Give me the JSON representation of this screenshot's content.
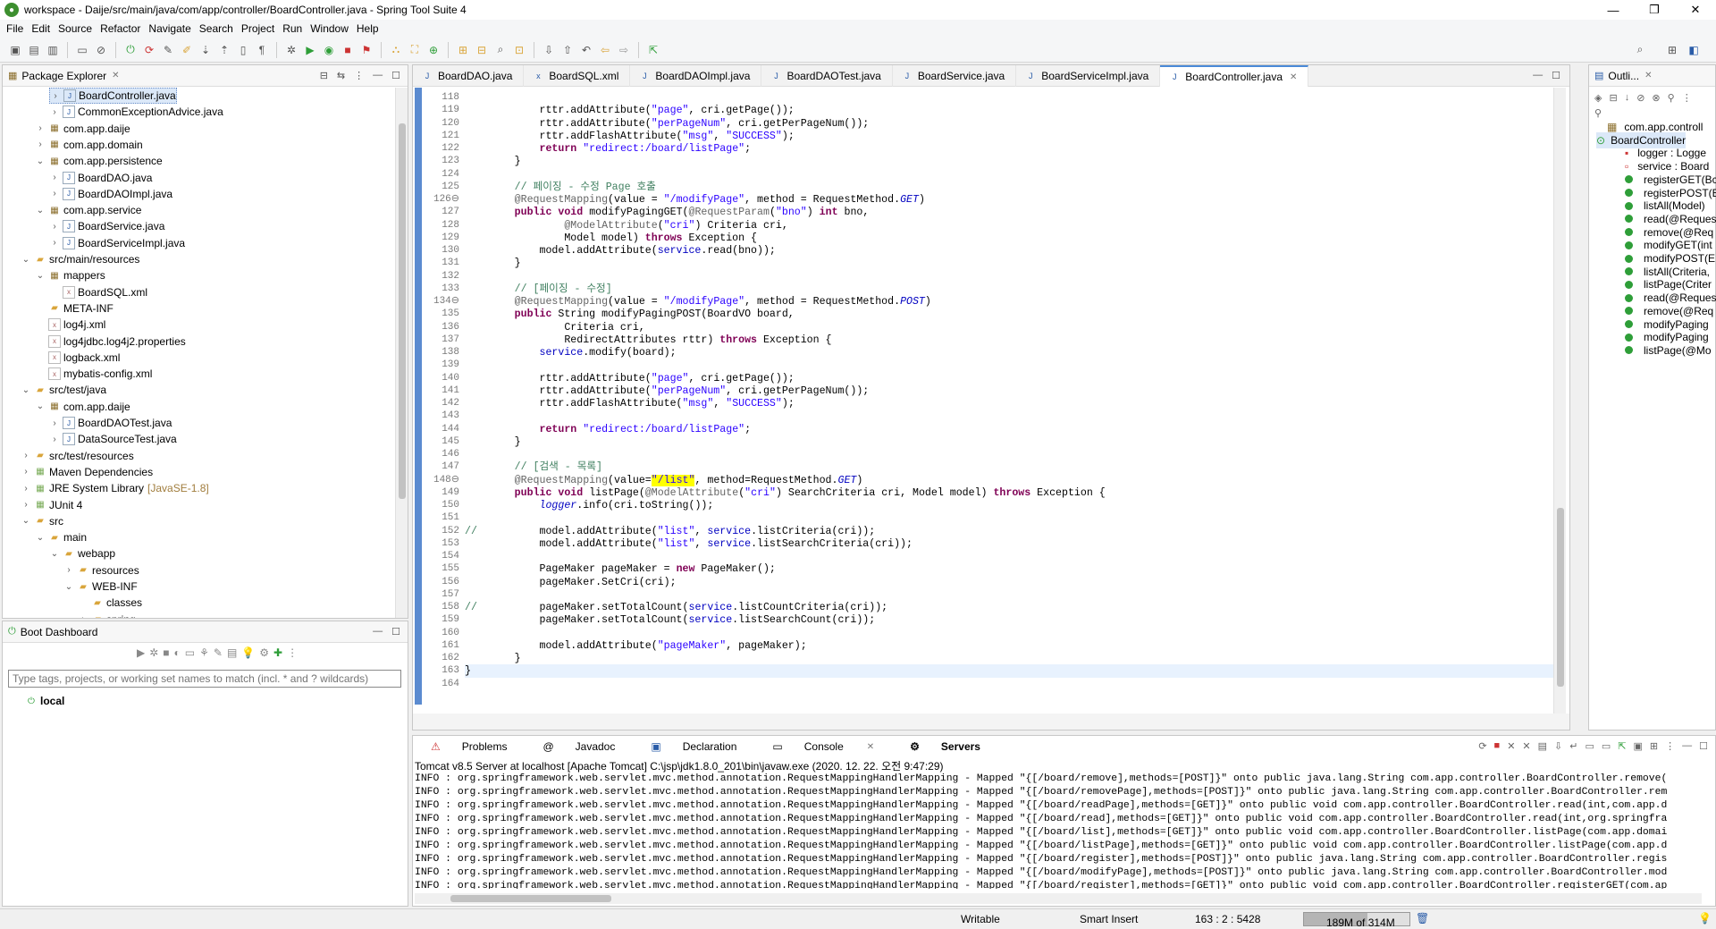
{
  "window": {
    "title": "workspace - Daije/src/main/java/com/app/controller/BoardController.java - Spring Tool Suite 4",
    "minimize": "—",
    "maximize": "❐",
    "close": "✕"
  },
  "menu": [
    "File",
    "Edit",
    "Source",
    "Refactor",
    "Navigate",
    "Search",
    "Project",
    "Run",
    "Window",
    "Help"
  ],
  "package_explorer": {
    "title": "Package Explorer",
    "items": [
      {
        "indent": 3,
        "arrow": ">",
        "icon": "java",
        "label": "BoardController.java"
      },
      {
        "indent": 3,
        "arrow": ">",
        "icon": "java",
        "label": "CommonExceptionAdvice.java"
      },
      {
        "indent": 2,
        "arrow": ">",
        "icon": "pkg",
        "label": "com.app.daije"
      },
      {
        "indent": 2,
        "arrow": ">",
        "icon": "pkg",
        "label": "com.app.domain"
      },
      {
        "indent": 2,
        "arrow": "v",
        "icon": "pkg",
        "label": "com.app.persistence"
      },
      {
        "indent": 3,
        "arrow": ">",
        "icon": "java",
        "label": "BoardDAO.java"
      },
      {
        "indent": 3,
        "arrow": ">",
        "icon": "java",
        "label": "BoardDAOImpl.java"
      },
      {
        "indent": 2,
        "arrow": "v",
        "icon": "pkg",
        "label": "com.app.service"
      },
      {
        "indent": 3,
        "arrow": ">",
        "icon": "java",
        "label": "BoardService.java"
      },
      {
        "indent": 3,
        "arrow": ">",
        "icon": "java",
        "label": "BoardServiceImpl.java"
      },
      {
        "indent": 1,
        "arrow": "v",
        "icon": "fold",
        "label": "src/main/resources"
      },
      {
        "indent": 2,
        "arrow": "v",
        "icon": "pkg",
        "label": "mappers"
      },
      {
        "indent": 3,
        "arrow": "",
        "icon": "xml",
        "label": "BoardSQL.xml"
      },
      {
        "indent": 2,
        "arrow": "",
        "icon": "fold",
        "label": "META-INF"
      },
      {
        "indent": 2,
        "arrow": "",
        "icon": "xml",
        "label": "log4j.xml"
      },
      {
        "indent": 2,
        "arrow": "",
        "icon": "xml",
        "label": "log4jdbc.log4j2.properties"
      },
      {
        "indent": 2,
        "arrow": "",
        "icon": "xml",
        "label": "logback.xml"
      },
      {
        "indent": 2,
        "arrow": "",
        "icon": "xml",
        "label": "mybatis-config.xml"
      },
      {
        "indent": 1,
        "arrow": "v",
        "icon": "fold",
        "label": "src/test/java"
      },
      {
        "indent": 2,
        "arrow": "v",
        "icon": "pkg",
        "label": "com.app.daije"
      },
      {
        "indent": 3,
        "arrow": ">",
        "icon": "java",
        "label": "BoardDAOTest.java"
      },
      {
        "indent": 3,
        "arrow": ">",
        "icon": "java",
        "label": "DataSourceTest.java"
      },
      {
        "indent": 1,
        "arrow": ">",
        "icon": "fold",
        "label": "src/test/resources"
      },
      {
        "indent": 1,
        "arrow": ">",
        "icon": "lib",
        "label": "Maven Dependencies"
      },
      {
        "indent": 1,
        "arrow": ">",
        "icon": "lib",
        "label": "JRE System Library",
        "suffix": "[JavaSE-1.8]"
      },
      {
        "indent": 1,
        "arrow": ">",
        "icon": "lib",
        "label": "JUnit 4"
      },
      {
        "indent": 1,
        "arrow": "v",
        "icon": "fold",
        "label": "src"
      },
      {
        "indent": 2,
        "arrow": "v",
        "icon": "fold",
        "label": "main"
      },
      {
        "indent": 3,
        "arrow": "v",
        "icon": "fold",
        "label": "webapp"
      },
      {
        "indent": 4,
        "arrow": ">",
        "icon": "fold",
        "label": "resources"
      },
      {
        "indent": 4,
        "arrow": "v",
        "icon": "fold",
        "label": "WEB-INF"
      },
      {
        "indent": 5,
        "arrow": "",
        "icon": "fold",
        "label": "classes"
      },
      {
        "indent": 5,
        "arrow": ">",
        "icon": "fold",
        "label": "spring"
      }
    ]
  },
  "boot_dashboard": {
    "title": "Boot Dashboard",
    "search_placeholder": "Type tags, projects, or working set names to match (incl. * and ? wildcards)",
    "local_label": "local"
  },
  "editor": {
    "tabs": [
      "BoardDAO.java",
      "BoardSQL.xml",
      "BoardDAOImpl.java",
      "BoardDAOTest.java",
      "BoardService.java",
      "BoardServiceImpl.java",
      "BoardController.java"
    ],
    "active_tab": "BoardController.java",
    "lines": [
      {
        "n": "118",
        "t": ""
      },
      {
        "n": "119",
        "t": "            rttr.addAttribute(\"page\", cri.getPage());"
      },
      {
        "n": "120",
        "t": "            rttr.addAttribute(\"perPageNum\", cri.getPerPageNum());"
      },
      {
        "n": "121",
        "t": "            rttr.addFlashAttribute(\"msg\", \"SUCCESS\");"
      },
      {
        "n": "122",
        "t": "            return \"redirect:/board/listPage\";"
      },
      {
        "n": "123",
        "t": "        }"
      },
      {
        "n": "124",
        "t": ""
      },
      {
        "n": "125",
        "t": "        // 페이징 - 수정 Page 호출"
      },
      {
        "n": "126⊖",
        "t": "        @RequestMapping(value = \"/modifyPage\", method = RequestMethod.GET)"
      },
      {
        "n": "127",
        "t": "        public void modifyPagingGET(@RequestParam(\"bno\") int bno,"
      },
      {
        "n": "128",
        "t": "                @ModelAttribute(\"cri\") Criteria cri,"
      },
      {
        "n": "129",
        "t": "                Model model) throws Exception {"
      },
      {
        "n": "130",
        "t": "            model.addAttribute(service.read(bno));"
      },
      {
        "n": "131",
        "t": "        }"
      },
      {
        "n": "132",
        "t": ""
      },
      {
        "n": "133",
        "t": "        // [페이징 - 수정]"
      },
      {
        "n": "134⊖",
        "t": "        @RequestMapping(value = \"/modifyPage\", method = RequestMethod.POST)"
      },
      {
        "n": "135",
        "t": "        public String modifyPagingPOST(BoardVO board,"
      },
      {
        "n": "136",
        "t": "                Criteria cri,"
      },
      {
        "n": "137",
        "t": "                RedirectAttributes rttr) throws Exception {"
      },
      {
        "n": "138",
        "t": "            service.modify(board);"
      },
      {
        "n": "139",
        "t": ""
      },
      {
        "n": "140",
        "t": "            rttr.addAttribute(\"page\", cri.getPage());"
      },
      {
        "n": "141",
        "t": "            rttr.addAttribute(\"perPageNum\", cri.getPerPageNum());"
      },
      {
        "n": "142",
        "t": "            rttr.addFlashAttribute(\"msg\", \"SUCCESS\");"
      },
      {
        "n": "143",
        "t": ""
      },
      {
        "n": "144",
        "t": "            return \"redirect:/board/listPage\";"
      },
      {
        "n": "145",
        "t": "        }"
      },
      {
        "n": "146",
        "t": ""
      },
      {
        "n": "147",
        "t": "        // [검색 - 목록]"
      },
      {
        "n": "148⊖",
        "t": "        @RequestMapping(value=\"/list\", method=RequestMethod.GET)"
      },
      {
        "n": "149",
        "t": "        public void listPage(@ModelAttribute(\"cri\") SearchCriteria cri, Model model) throws Exception {"
      },
      {
        "n": "150",
        "t": "            logger.info(cri.toString());"
      },
      {
        "n": "151",
        "t": ""
      },
      {
        "n": "152",
        "t": "//          model.addAttribute(\"list\", service.listCriteria(cri));"
      },
      {
        "n": "153",
        "t": "            model.addAttribute(\"list\", service.listSearchCriteria(cri));"
      },
      {
        "n": "154",
        "t": ""
      },
      {
        "n": "155",
        "t": "            PageMaker pageMaker = new PageMaker();"
      },
      {
        "n": "156",
        "t": "            pageMaker.SetCri(cri);"
      },
      {
        "n": "157",
        "t": ""
      },
      {
        "n": "158",
        "t": "//          pageMaker.setTotalCount(service.listCountCriteria(cri));"
      },
      {
        "n": "159",
        "t": "            pageMaker.setTotalCount(service.listSearchCount(cri));"
      },
      {
        "n": "160",
        "t": ""
      },
      {
        "n": "161",
        "t": "            model.addAttribute(\"pageMaker\", pageMaker);"
      },
      {
        "n": "162",
        "t": "        }"
      },
      {
        "n": "163",
        "t": "}"
      },
      {
        "n": "164",
        "t": ""
      }
    ]
  },
  "outline": {
    "title": "Outli...",
    "items": [
      {
        "kind": "pkg",
        "label": "com.app.controll"
      },
      {
        "kind": "class",
        "label": "BoardController"
      },
      {
        "kind": "field-sf",
        "label": "logger : Logge"
      },
      {
        "kind": "field",
        "label": "service : Board"
      },
      {
        "kind": "method",
        "label": "registerGET(Bc"
      },
      {
        "kind": "method",
        "label": "registerPOST(E"
      },
      {
        "kind": "method",
        "label": "listAll(Model)"
      },
      {
        "kind": "method",
        "label": "read(@Reques"
      },
      {
        "kind": "method",
        "label": "remove(@Req"
      },
      {
        "kind": "method",
        "label": "modifyGET(int"
      },
      {
        "kind": "method",
        "label": "modifyPOST(E"
      },
      {
        "kind": "method",
        "label": "listAll(Criteria,"
      },
      {
        "kind": "method",
        "label": "listPage(Criter"
      },
      {
        "kind": "method",
        "label": "read(@Reques"
      },
      {
        "kind": "method",
        "label": "remove(@Req"
      },
      {
        "kind": "method",
        "label": "modifyPaging"
      },
      {
        "kind": "method",
        "label": "modifyPaging"
      },
      {
        "kind": "method",
        "label": "listPage(@Mo"
      }
    ]
  },
  "console": {
    "tabs": [
      "Problems",
      "Javadoc",
      "Declaration",
      "Console",
      "Servers"
    ],
    "active_tab": "Servers",
    "header": "Tomcat v8.5 Server at localhost [Apache Tomcat] C:\\jsp\\jdk1.8.0_201\\bin\\javaw.exe  (2020. 12. 22. 오전 9:47:29)",
    "lines": [
      "INFO : org.springframework.web.servlet.mvc.method.annotation.RequestMappingHandlerMapping - Mapped \"{[/board/remove],methods=[POST]}\" onto public java.lang.String com.app.controller.BoardController.remove(",
      "INFO : org.springframework.web.servlet.mvc.method.annotation.RequestMappingHandlerMapping - Mapped \"{[/board/removePage],methods=[POST]}\" onto public java.lang.String com.app.controller.BoardController.rem",
      "INFO : org.springframework.web.servlet.mvc.method.annotation.RequestMappingHandlerMapping - Mapped \"{[/board/readPage],methods=[GET]}\" onto public void com.app.controller.BoardController.read(int,com.app.d",
      "INFO : org.springframework.web.servlet.mvc.method.annotation.RequestMappingHandlerMapping - Mapped \"{[/board/read],methods=[GET]}\" onto public void com.app.controller.BoardController.read(int,org.springfra",
      "INFO : org.springframework.web.servlet.mvc.method.annotation.RequestMappingHandlerMapping - Mapped \"{[/board/list],methods=[GET]}\" onto public void com.app.controller.BoardController.listPage(com.app.domai",
      "INFO : org.springframework.web.servlet.mvc.method.annotation.RequestMappingHandlerMapping - Mapped \"{[/board/listPage],methods=[GET]}\" onto public void com.app.controller.BoardController.listPage(com.app.d",
      "INFO : org.springframework.web.servlet.mvc.method.annotation.RequestMappingHandlerMapping - Mapped \"{[/board/register],methods=[POST]}\" onto public java.lang.String com.app.controller.BoardController.regis",
      "INFO : org.springframework.web.servlet.mvc.method.annotation.RequestMappingHandlerMapping - Mapped \"{[/board/modifyPage],methods=[POST]}\" onto public java.lang.String com.app.controller.BoardController.mod",
      "INFO : org.springframework.web.servlet.mvc.method.annotation.RequestMappingHandlerMapping - Mapped \"{[/board/register],methods=[GET]}\" onto public void com.app.controller.BoardController.registerGET(com.ap"
    ]
  },
  "statusbar": {
    "mode": "Writable",
    "insert": "Smart Insert",
    "position": "163 : 2 : 5428",
    "heap": "189M of 314M",
    "heap_fraction": 0.6
  }
}
